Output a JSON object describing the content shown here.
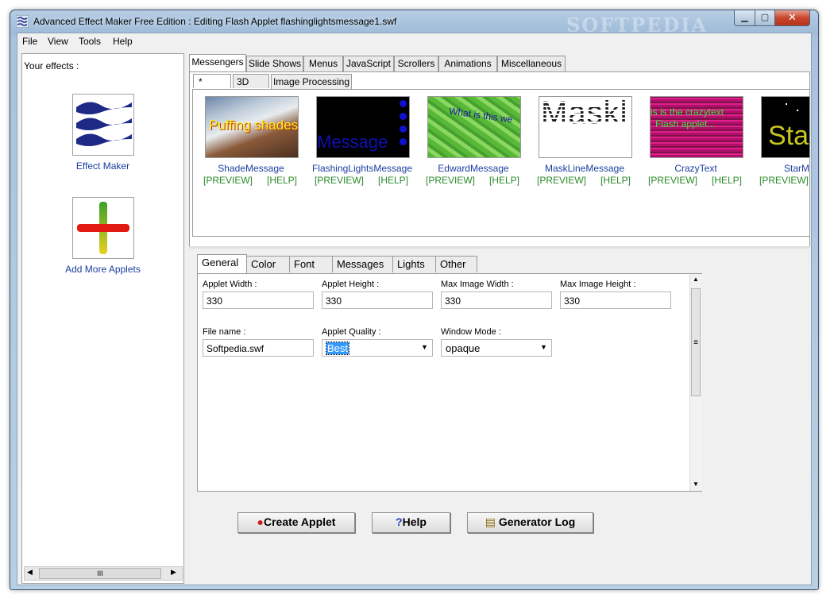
{
  "window": {
    "title": "Advanced Effect Maker Free Edition : Editing Flash Applet flashinglightsmessage1.swf",
    "watermark": "SOFTPEDIA",
    "minimize_glyph": "▁",
    "maximize_glyph": "▢",
    "close_glyph": "✕"
  },
  "menu": [
    "File",
    "View",
    "Tools",
    "Help"
  ],
  "left_panel": {
    "heading": "Your effects :",
    "items": [
      "Effect Maker",
      "Add More Applets"
    ],
    "scroll_thumb": "III"
  },
  "effect_tabs": [
    "Messengers",
    "Slide Shows",
    "Menus",
    "JavaScript",
    "Scrollers",
    "Animations",
    "Miscellaneous"
  ],
  "effect_subtabs": [
    "*",
    "3D",
    "Image Processing"
  ],
  "effects": [
    {
      "name": "ShadeMessage",
      "thumb_text": "Puffing shades",
      "preview": "[PREVIEW]",
      "help": "[HELP]"
    },
    {
      "name": "FlashingLightsMessage",
      "thumb_text": "Message",
      "preview": "[PREVIEW]",
      "help": "[HELP]"
    },
    {
      "name": "EdwardMessage",
      "thumb_text": "What is this we",
      "preview": "[PREVIEW]",
      "help": "[HELP]"
    },
    {
      "name": "MaskLineMessage",
      "thumb_text": "Maskl",
      "preview": "[PREVIEW]",
      "help": "[HELP]"
    },
    {
      "name": "CrazyText",
      "thumb_text": "is is the crazytext",
      "thumb_text2": "Flash applet...",
      "preview": "[PREVIEW]",
      "help": "[HELP]"
    },
    {
      "name": "StarMe",
      "thumb_text": "Sta",
      "preview": "[PREVIEW]"
    }
  ],
  "settings_tabs": [
    "General",
    "Color",
    "Font",
    "Messages",
    "Lights",
    "Other"
  ],
  "fields": {
    "applet_width": {
      "label": "Applet Width :",
      "value": "330"
    },
    "applet_height": {
      "label": "Applet Height :",
      "value": "330"
    },
    "max_image_width": {
      "label": "Max Image Width :",
      "value": "330"
    },
    "max_image_height": {
      "label": "Max Image Height :",
      "value": "330"
    },
    "file_name": {
      "label": "File name :",
      "value": "Softpedia.swf"
    },
    "applet_quality": {
      "label": "Applet Quality :",
      "value": "Best"
    },
    "window_mode": {
      "label": "Window Mode :",
      "value": "opaque"
    }
  },
  "scroll_grip": "≡",
  "buttons": {
    "create": "Create Applet",
    "help": "Help",
    "log": "Generator Log"
  },
  "colors": {
    "link_blue": "#1a3ea0",
    "link_green": "#2a8a2a",
    "selection": "#3399ff"
  }
}
